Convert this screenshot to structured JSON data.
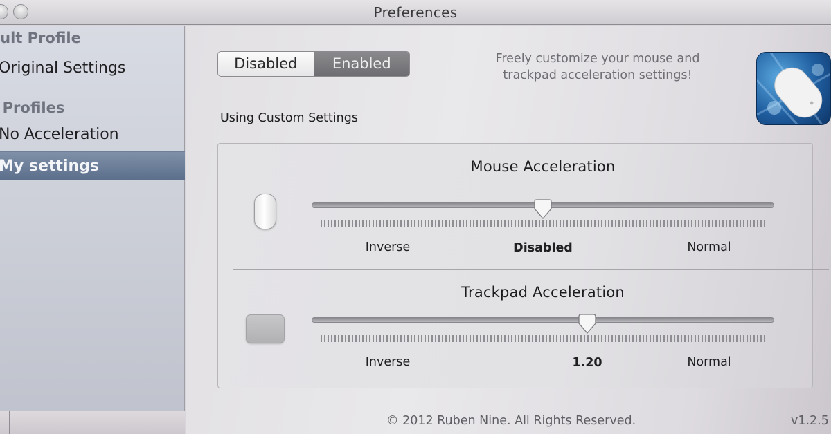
{
  "window": {
    "title": "Preferences"
  },
  "sidebar": {
    "groups": [
      {
        "header": "ault Profile",
        "items": [
          {
            "label": "Original Settings",
            "selected": false
          }
        ]
      },
      {
        "header": "r Profiles",
        "items": [
          {
            "label": "No Acceleration",
            "selected": false
          },
          {
            "label": "My settings",
            "selected": true
          }
        ]
      }
    ]
  },
  "toggle": {
    "options": [
      "Disabled",
      "Enabled"
    ],
    "selected": "Enabled"
  },
  "tagline": {
    "line1": "Freely customize your mouse and",
    "line2": "trackpad acceleration settings!"
  },
  "status": "Using Custom Settings",
  "mouse": {
    "title": "Mouse Acceleration",
    "left_label": "Inverse",
    "value_label": "Disabled",
    "right_label": "Normal",
    "position": 0.5
  },
  "trackpad": {
    "title": "Trackpad Acceleration",
    "left_label": "Inverse",
    "value_label": "1.20",
    "right_label": "Normal",
    "position": 0.6
  },
  "footer": {
    "copyright": "© 2012 Ruben Nine. All Rights Reserved.",
    "version": "v1.2.5"
  },
  "colors": {
    "selection": "#6a7c96",
    "icon_blue": "#1f5d9f"
  }
}
